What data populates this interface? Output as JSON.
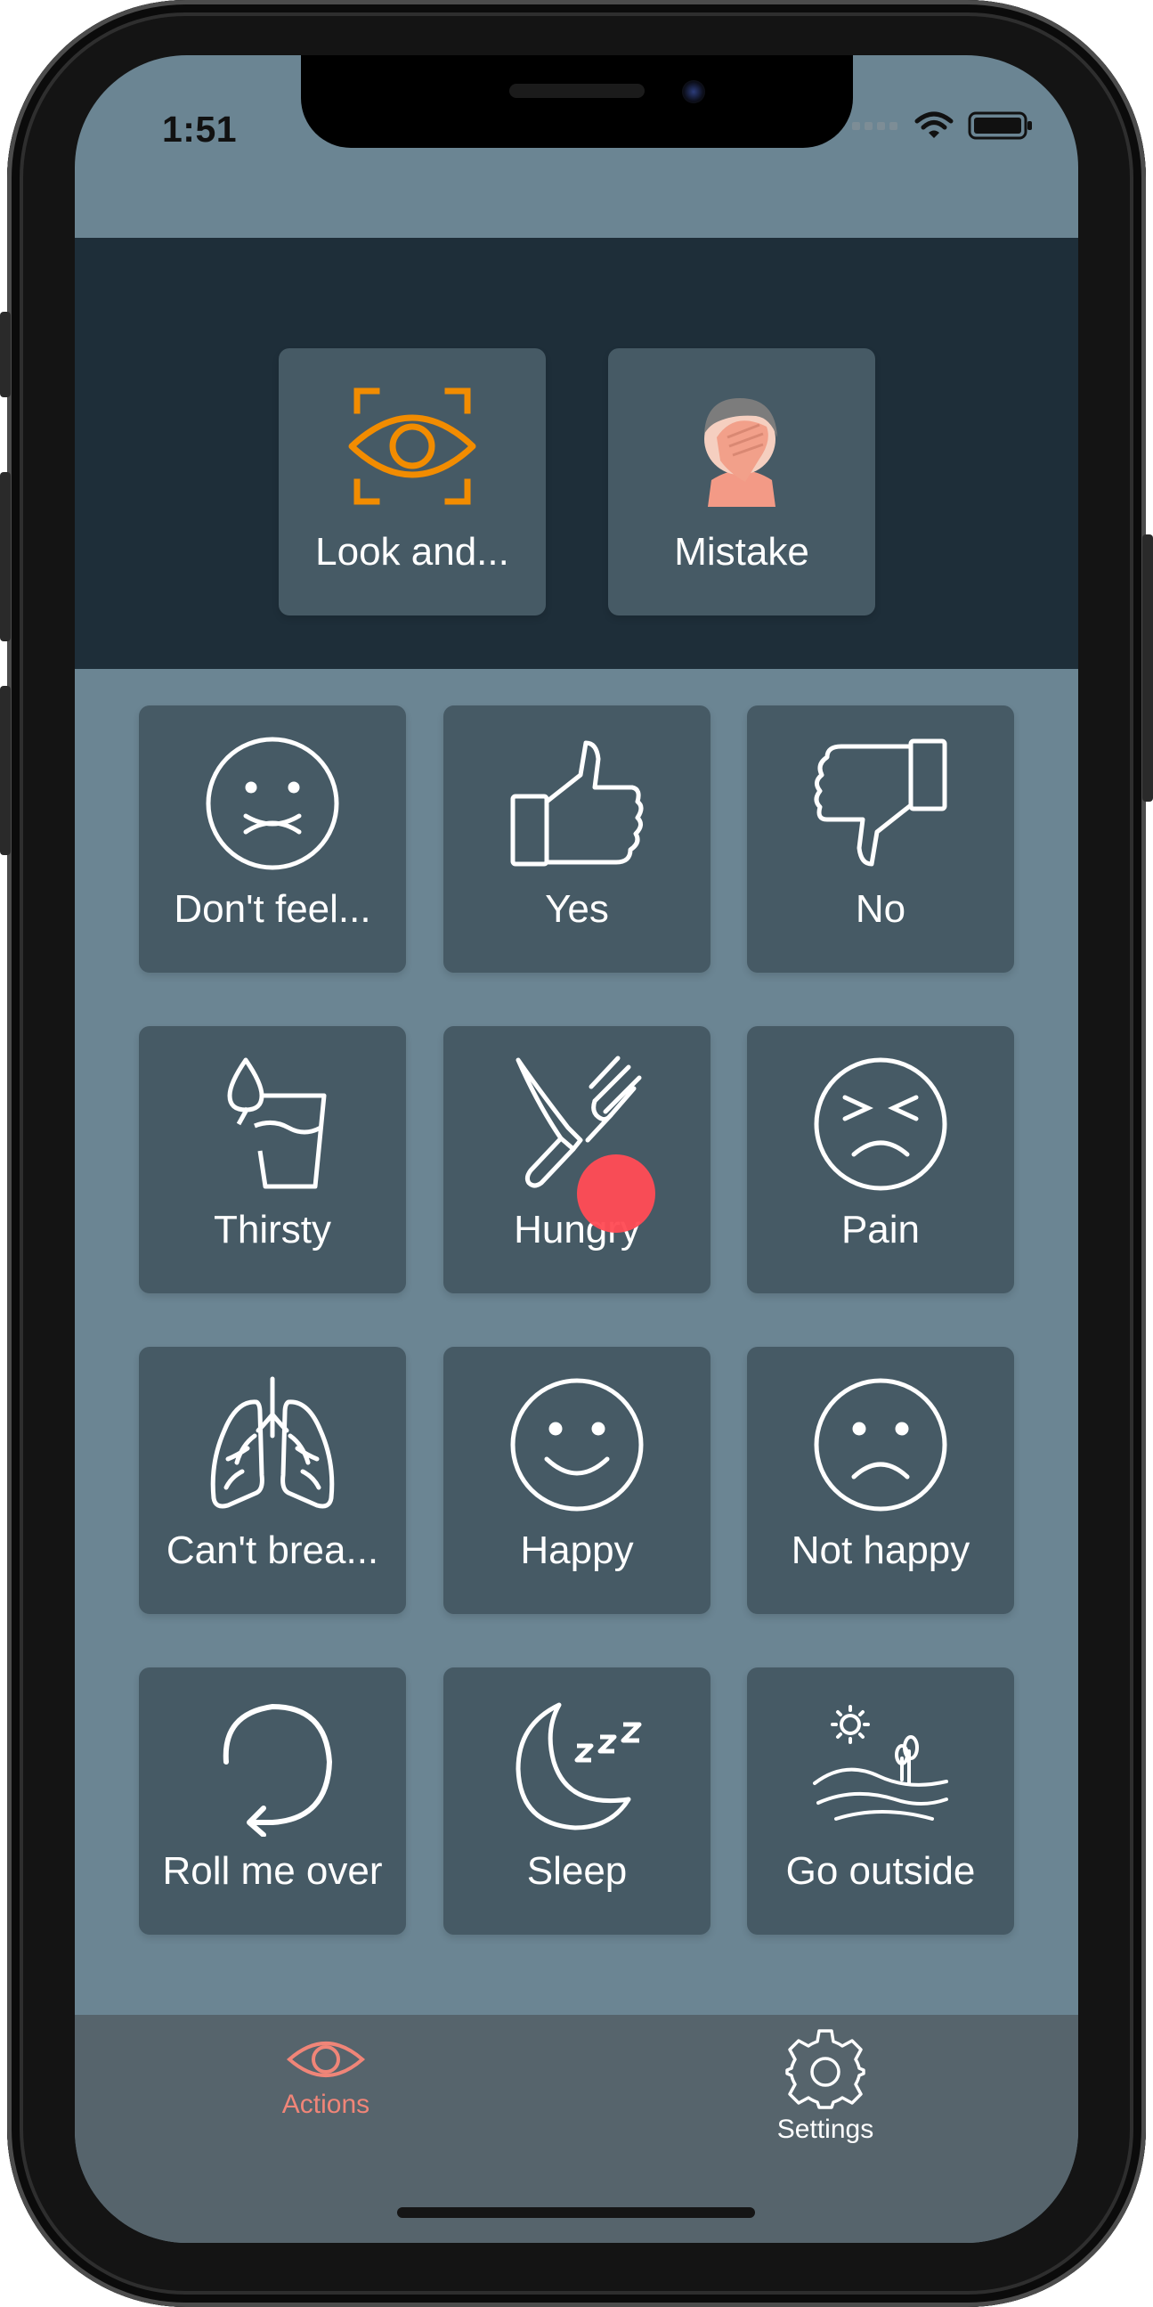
{
  "status_bar": {
    "time": "1:51"
  },
  "quick_actions": [
    {
      "label": "Look and...",
      "icon": "eye-focus-icon"
    },
    {
      "label": "Mistake",
      "icon": "facepalm-icon"
    }
  ],
  "grid": [
    {
      "label": "Don't feel...",
      "icon": "sick-face-icon"
    },
    {
      "label": "Yes",
      "icon": "thumbs-up-icon"
    },
    {
      "label": "No",
      "icon": "thumbs-down-icon"
    },
    {
      "label": "Thirsty",
      "icon": "water-glass-icon"
    },
    {
      "label": "Hungry",
      "icon": "knife-fork-icon"
    },
    {
      "label": "Pain",
      "icon": "pain-face-icon"
    },
    {
      "label": "Can't brea...",
      "icon": "lungs-icon"
    },
    {
      "label": "Happy",
      "icon": "happy-face-icon"
    },
    {
      "label": "Not happy",
      "icon": "sad-face-icon"
    },
    {
      "label": "Roll me over",
      "icon": "rotate-icon"
    },
    {
      "label": "Sleep",
      "icon": "moon-zzz-icon"
    },
    {
      "label": "Go outside",
      "icon": "landscape-icon"
    }
  ],
  "tab_bar": {
    "tabs": [
      {
        "label": "Actions",
        "icon": "eye-icon",
        "active": true
      },
      {
        "label": "Settings",
        "icon": "gear-icon",
        "active": false
      }
    ]
  },
  "colors": {
    "background": "#6b8593",
    "top_panel": "#1e2e39",
    "tile": "#465a65",
    "tab_bar": "#56646c",
    "accent_orange": "#f28c00",
    "active_tab": "#f08578",
    "touch_indicator": "#ff4c55"
  }
}
